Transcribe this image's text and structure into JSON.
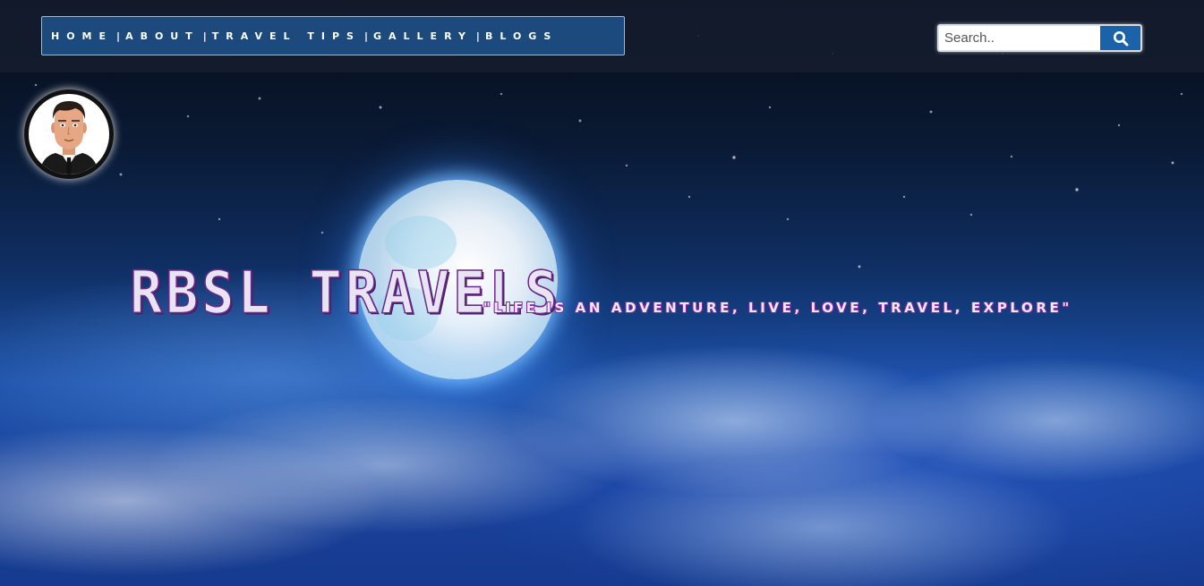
{
  "nav": {
    "items": [
      {
        "label": "HOME"
      },
      {
        "label": "ABOUT"
      },
      {
        "label": "TRAVEL TIPS"
      },
      {
        "label": "GALLERY"
      },
      {
        "label": "BLOGS"
      }
    ],
    "separator": "|"
  },
  "search": {
    "placeholder": "Search..",
    "value": "",
    "button_icon": "search-icon"
  },
  "avatar": {
    "icon": "avatar-cartoon-man-in-suit"
  },
  "hero": {
    "brand": "RBSL TRAVELS",
    "tagline": "\"LIFE IS AN ADVENTURE, LIVE, LOVE, TRAVEL, EXPLORE\"",
    "background": "night-sky-moon-clouds"
  },
  "colors": {
    "nav_background": "#1d4a7c",
    "header_background": "#141c2d",
    "search_button": "#1c62a8",
    "brand_outline": "#6a2a8c"
  }
}
